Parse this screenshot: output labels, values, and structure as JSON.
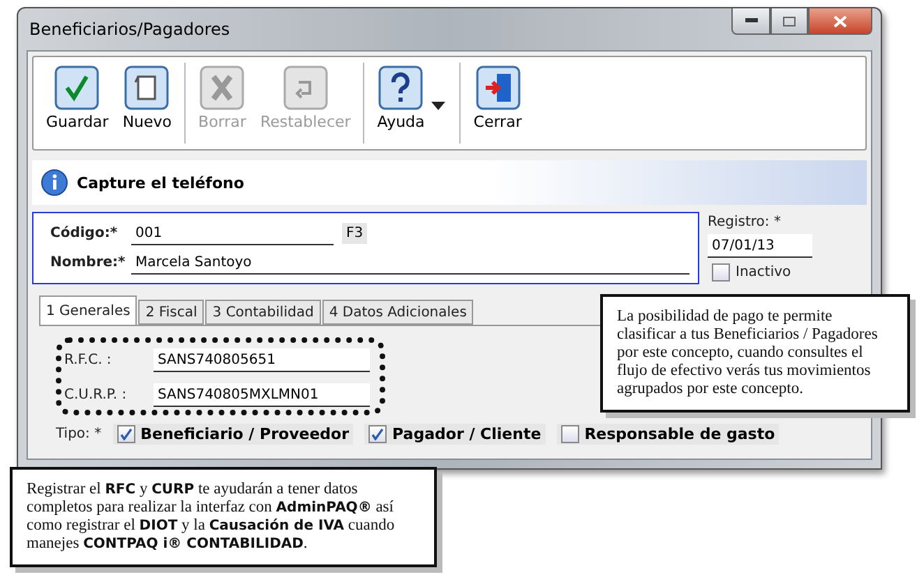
{
  "window": {
    "title": "Beneficiarios/Pagadores"
  },
  "toolbar": [
    {
      "kind": "save",
      "label": "Guardar",
      "disabled": false
    },
    {
      "kind": "new",
      "label": "Nuevo",
      "disabled": false
    },
    {
      "kind": "delete",
      "label": "Borrar",
      "disabled": true
    },
    {
      "kind": "reset",
      "label": "Restablecer",
      "disabled": true
    },
    {
      "kind": "help",
      "label": "Ayuda",
      "disabled": false,
      "has_menu": true
    },
    {
      "kind": "close",
      "label": "Cerrar",
      "disabled": false
    }
  ],
  "info_bar": {
    "message": "Capture el teléfono"
  },
  "form": {
    "codigo": {
      "label": "Código:*",
      "value": "001",
      "key_hint": "F3"
    },
    "nombre": {
      "label": "Nombre:*",
      "value": "Marcela Santoyo"
    },
    "registro": {
      "label": "Registro: *",
      "value": "07/01/13"
    },
    "inactivo": {
      "label": "Inactivo",
      "checked": false
    }
  },
  "tabs": [
    {
      "label": "1 Generales",
      "selected": true
    },
    {
      "label": "2 Fiscal",
      "selected": false
    },
    {
      "label": "3 Contabilidad",
      "selected": false
    },
    {
      "label": "4 Datos Adicionales",
      "selected": false
    }
  ],
  "generales": {
    "rfc": {
      "label": "R.F.C. :",
      "value": "SANS740805651"
    },
    "curp": {
      "label": "C.U.R.P. :",
      "value": "SANS740805MXLMN01"
    },
    "tipo_label": "Tipo: *",
    "tipo": [
      {
        "label": "Beneficiario / Proveedor",
        "checked": true
      },
      {
        "label": "Pagador / Cliente",
        "checked": true
      },
      {
        "label": "Responsable de gasto",
        "checked": false
      }
    ]
  },
  "callouts": [
    {
      "kind": "right",
      "text": "La posibilidad de pago te permite clasificar a tus Beneficiarios / Pagadores por este concepto, cuando consultes el flujo de efectivo verás tus movimientos agrupados por este concepto."
    },
    {
      "kind": "bottom",
      "text": "Registrar el **RFC** y **CURP** te ayudarán a tener datos completos para realizar la interfaz con **AdminPAQ®** así como registrar el **DIOT** y la **Causación de IVA** cuando manejes **CONTPAQ i® CONTABILIDAD**."
    }
  ]
}
